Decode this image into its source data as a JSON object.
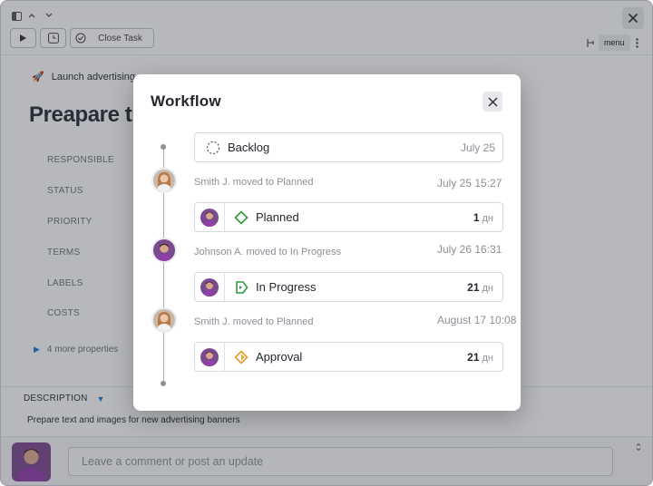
{
  "toolbar": {
    "close_task_label": "Close Task",
    "menu_label": "menu"
  },
  "task": {
    "breadcrumb": "Launch advertising c",
    "title": "Preapare th",
    "properties": [
      "RESPONSIBLE",
      "STATUS",
      "PRIORITY",
      "TERMS",
      "LABELS",
      "COSTS"
    ],
    "more_properties": "4 more properties",
    "description_label": "DESCRIPTION",
    "description_text": "Prepare text and images for new advertising banners"
  },
  "comment": {
    "placeholder": "Leave a comment or post an update"
  },
  "modal": {
    "title": "Workflow",
    "stages": [
      {
        "name": "Backlog",
        "date": "July 25"
      },
      {
        "name": "Planned",
        "duration": "1",
        "unit": "дн"
      },
      {
        "name": "In Progress",
        "duration": "21",
        "unit": "дн"
      },
      {
        "name": "Approval",
        "duration": "21",
        "unit": "дн"
      }
    ],
    "events": [
      {
        "text": "Smith J. moved to Planned",
        "time": "July 25 15:27"
      },
      {
        "text": "Johnson A. moved to In Progress",
        "time": "July 26 16:31"
      },
      {
        "text": "Smith J. moved to Planned",
        "time": "August 17 10:08"
      }
    ]
  },
  "colors": {
    "accent": "#1f7ad6",
    "planned_green": "#2e9a3e",
    "approval_orange": "#e89a2c"
  }
}
